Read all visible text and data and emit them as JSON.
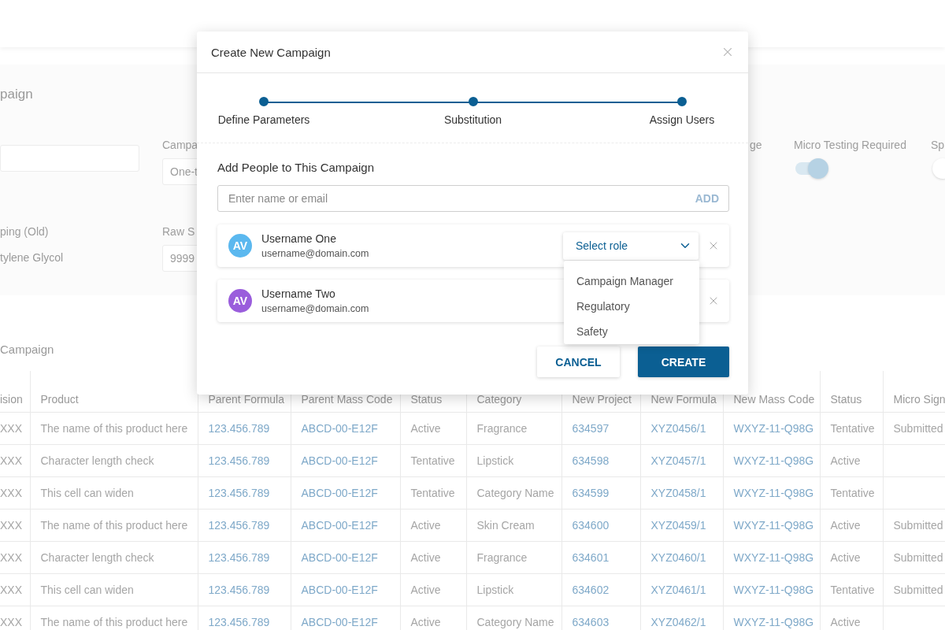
{
  "background": {
    "page_title": "paign",
    "form_rows": [
      [
        {
          "kind": "input"
        },
        {
          "kind": "input",
          "label": "Campa",
          "value": "One-t"
        },
        {
          "kind": "label",
          "label": "ge"
        },
        {
          "kind": "toggle",
          "label": "Micro Testing Required",
          "on": true
        },
        {
          "kind": "toggle",
          "label": "Sp",
          "on": false
        }
      ],
      [
        {
          "kind": "text",
          "label": "ping (Old)",
          "value": "tylene Glycol"
        },
        {
          "kind": "input",
          "label": "Raw S",
          "value": "9999"
        }
      ]
    ],
    "section_title": "Campaign",
    "table": {
      "columns": [
        {
          "label": "ision",
          "kind": "text"
        },
        {
          "label": "Product",
          "kind": "text"
        },
        {
          "label": "Parent Formula",
          "kind": "link"
        },
        {
          "label": "Parent Mass Code",
          "kind": "link"
        },
        {
          "label": "Status",
          "kind": "text"
        },
        {
          "label": "Category",
          "kind": "text"
        },
        {
          "label": "New Project",
          "kind": "link"
        },
        {
          "label": "New Formula",
          "kind": "link"
        },
        {
          "label": "New Mass Code",
          "kind": "link"
        },
        {
          "label": "Status",
          "kind": "text"
        },
        {
          "label": "Micro Sign",
          "kind": "text"
        }
      ],
      "rows": [
        [
          "XXX",
          "The name of this product here",
          "123.456.789",
          "ABCD-00-E12F",
          "Active",
          "Fragrance",
          "634597",
          "XYZ0456/1",
          "WXYZ-11-Q98G",
          "Tentative",
          "Submitted"
        ],
        [
          "XXX",
          "Character length check",
          "123.456.789",
          "ABCD-00-E12F",
          "Tentative",
          "Lipstick",
          "634598",
          "XYZ0457/1",
          "WXYZ-11-Q98G",
          "Active",
          null
        ],
        [
          "XXX",
          "This cell can widen",
          "123.456.789",
          "ABCD-00-E12F",
          "Tentative",
          "Category Name",
          "634599",
          "XYZ0458/1",
          "WXYZ-11-Q98G",
          "Tentative",
          null
        ],
        [
          "XXX",
          "The name of this product here",
          "123.456.789",
          "ABCD-00-E12F",
          "Active",
          "Skin Cream",
          "634600",
          "XYZ0459/1",
          "WXYZ-11-Q98G",
          "Active",
          "Submitted"
        ],
        [
          "XXX",
          "Character length check",
          "123.456.789",
          "ABCD-00-E12F",
          "Active",
          "Fragrance",
          "634601",
          "XYZ0460/1",
          "WXYZ-11-Q98G",
          "Active",
          "Submitted"
        ],
        [
          "XXX",
          "This cell can widen",
          "123.456.789",
          "ABCD-00-E12F",
          "Active",
          "Lipstick",
          "634602",
          "XYZ0461/1",
          "WXYZ-11-Q98G",
          "Tentative",
          "Submitted"
        ],
        [
          "XXX",
          "The name of this product here",
          "123.456.789",
          "ABCD-00-E12F",
          "Active",
          "Category Name",
          "634603",
          "XYZ0462/1",
          "WXYZ-11-Q98G",
          "Active",
          null
        ]
      ]
    }
  },
  "dialog": {
    "title": "Create New Campaign",
    "steps": [
      {
        "label": "Define Parameters",
        "completed": true
      },
      {
        "label": "Substitution",
        "completed": true
      },
      {
        "label": "Assign Users",
        "completed": true
      }
    ],
    "section_title": "Add People to This Campaign",
    "search": {
      "placeholder": "Enter name or email",
      "button": "ADD"
    },
    "users": [
      {
        "initials": "AV",
        "color": "#5bb8ef",
        "name": "Username One",
        "email": "username@domain.com",
        "role_select": {
          "placeholder": "Select role",
          "expanded": true,
          "options": [
            "Campaign Manager",
            "Regulatory",
            "Safety"
          ]
        }
      },
      {
        "initials": "AV",
        "color": "#9a5ddc",
        "name": "Username Two",
        "email": "username@domain.com"
      }
    ],
    "buttons": [
      {
        "label": "CANCEL",
        "kind": "secondary"
      },
      {
        "label": "CREATE",
        "kind": "primary"
      }
    ]
  }
}
